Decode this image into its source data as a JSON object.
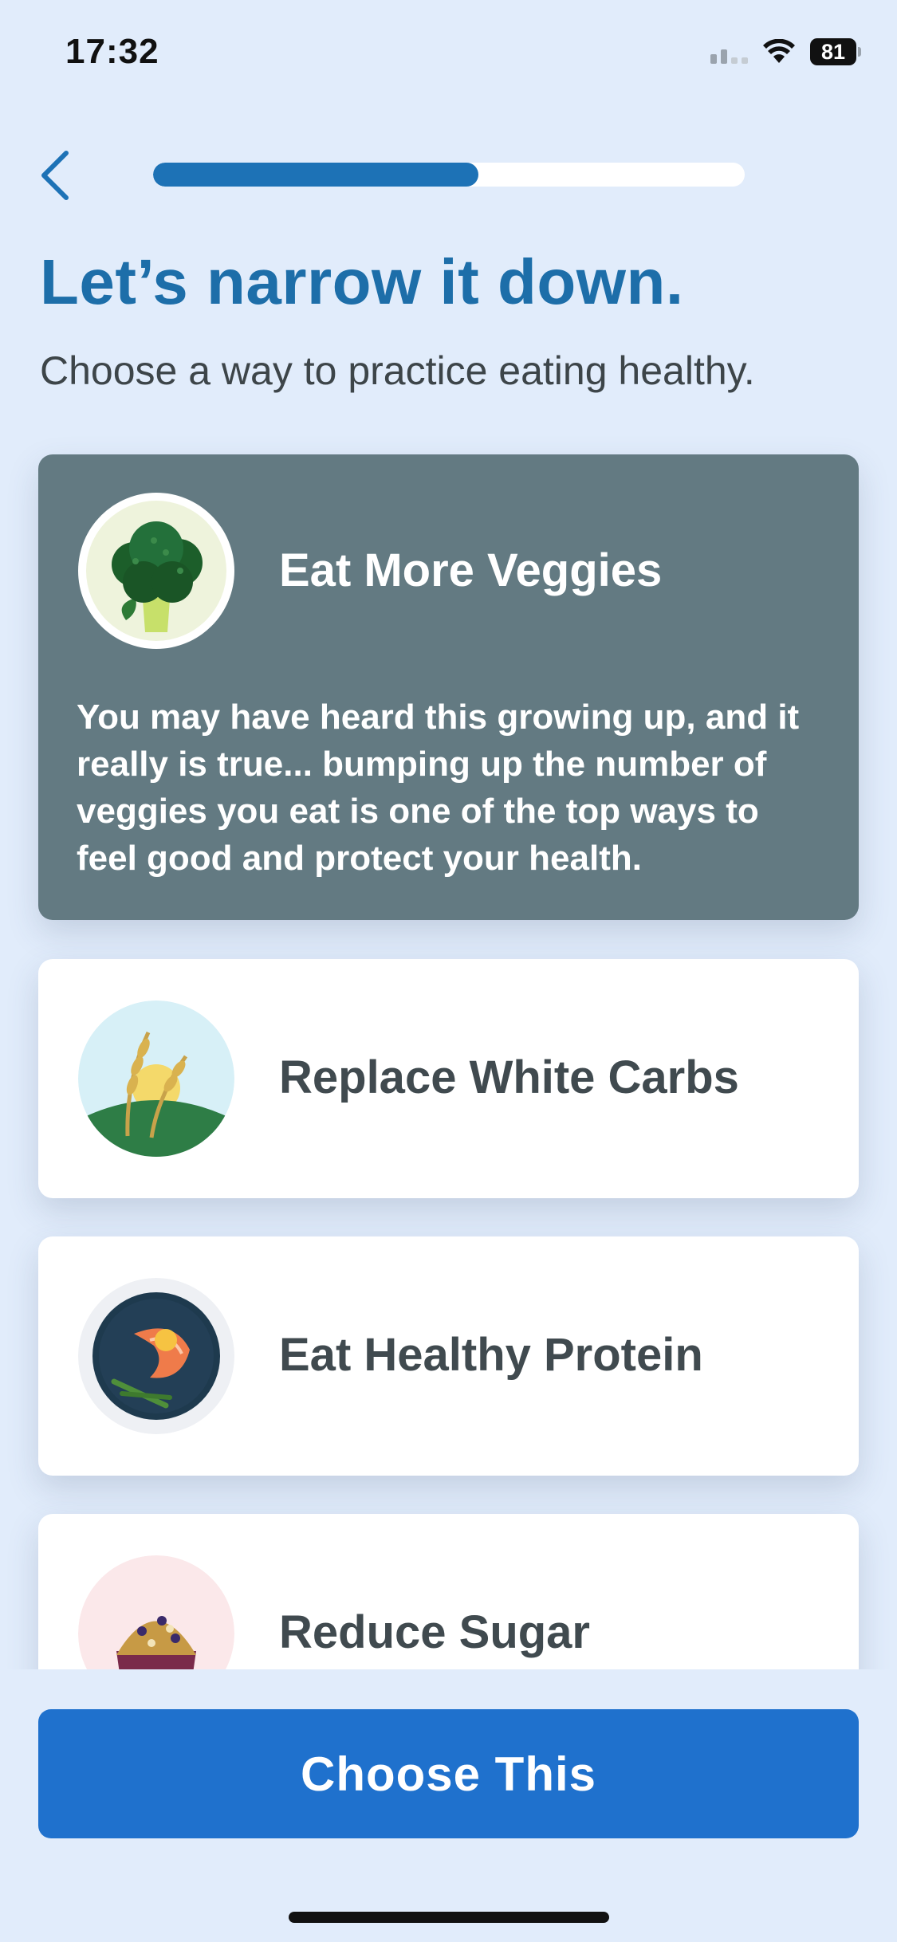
{
  "status_bar": {
    "time": "17:32",
    "battery": "81"
  },
  "progress": {
    "fraction": 0.55
  },
  "header": {
    "title": "Let’s narrow it down.",
    "subtitle": "Choose a way to practice eating healthy."
  },
  "options": [
    {
      "label": "Eat More Veggies",
      "icon": "broccoli-icon",
      "selected": true,
      "description": "You may have heard this growing up, and it really is true... bumping up the number of veggies you eat is one of the top ways to feel good and protect your health."
    },
    {
      "label": "Replace White Carbs",
      "icon": "wheat-icon",
      "selected": false
    },
    {
      "label": "Eat Healthy Protein",
      "icon": "salmon-icon",
      "selected": false
    },
    {
      "label": "Reduce Sugar",
      "icon": "muffin-icon",
      "selected": false
    }
  ],
  "cta": {
    "label": "Choose This"
  },
  "colors": {
    "accent": "#1f71cd",
    "title": "#1d6ea9",
    "selected_card": "#637a82",
    "background": "#e1ecfb"
  }
}
